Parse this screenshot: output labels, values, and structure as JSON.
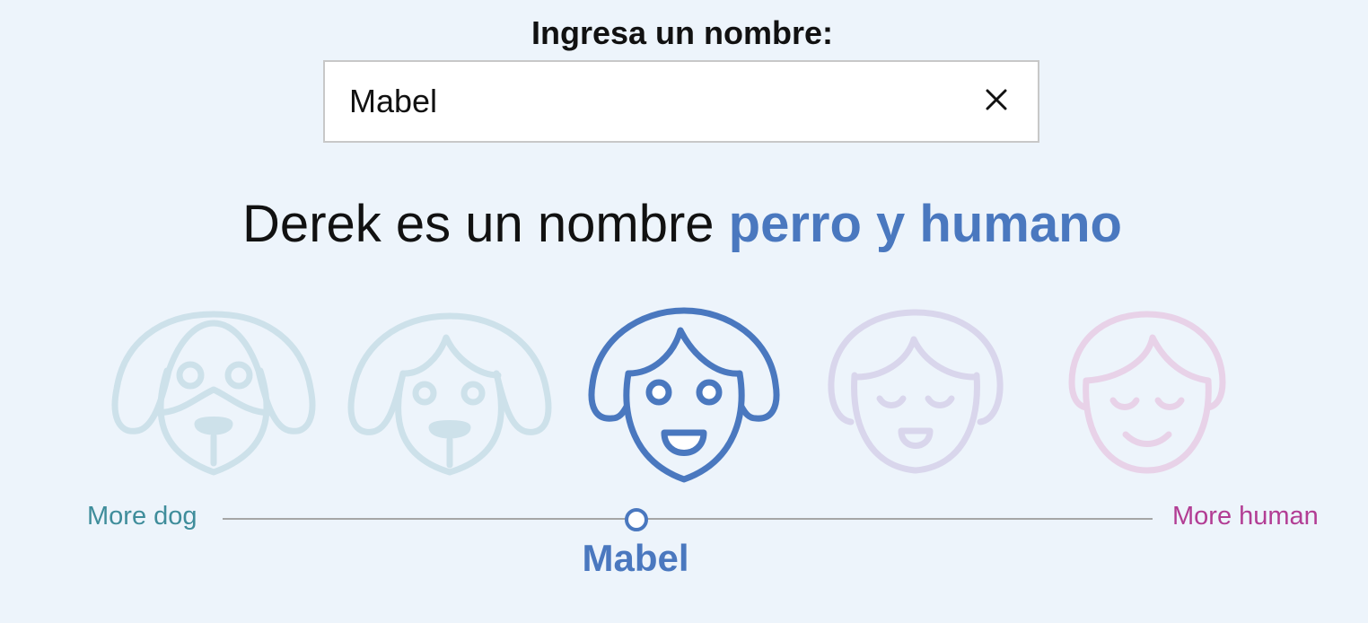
{
  "prompt": "Ingresa un nombre:",
  "name_input": {
    "value": "Mabel"
  },
  "result": {
    "prefix": "Derek es un nombre ",
    "category": "perro y humano"
  },
  "scale": {
    "left_label": "More dog",
    "right_label": "More human",
    "marker_label": "Mabel",
    "selected_index": 2,
    "faces": [
      "dog-face-icon",
      "dog-human-face-icon",
      "human-dog-face-icon",
      "human-face-icon",
      "human-face-icon"
    ]
  },
  "colors": {
    "background": "#edf4fb",
    "accent_blue": "#4a78bf",
    "dog_end": "#3f8d9b",
    "human_end": "#b23d94",
    "faded_dog": "#cde1ea",
    "faded_lavender": "#d9d6ec",
    "faded_pink": "#e8d2e8"
  }
}
